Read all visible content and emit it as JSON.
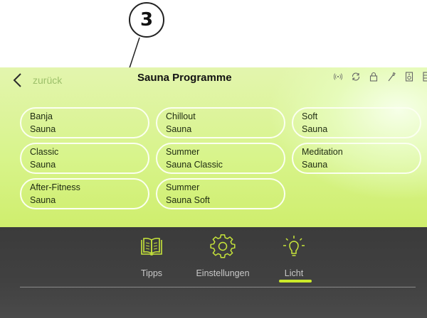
{
  "callout": {
    "number": "3"
  },
  "header": {
    "back_label": "zurück",
    "title": "Sauna Programme"
  },
  "status_icons": [
    "radio-signal-icon",
    "sync-icon",
    "lock-icon",
    "wrench-icon",
    "speaker-icon",
    "sauna-cabinet-icon"
  ],
  "programs": [
    {
      "name": "Banja",
      "type": "Sauna"
    },
    {
      "name": "Chillout",
      "type": "Sauna"
    },
    {
      "name": "Soft",
      "type": "Sauna"
    },
    {
      "name": "Classic",
      "type": "Sauna"
    },
    {
      "name": "Summer",
      "type": "Sauna Classic"
    },
    {
      "name": "Meditation",
      "type": "Sauna"
    },
    {
      "name": "After-Fitness",
      "type": "Sauna"
    },
    {
      "name": "Summer",
      "type": "Sauna Soft"
    }
  ],
  "nav": [
    {
      "label": "Tipps",
      "icon": "book-icon"
    },
    {
      "label": "Einstellungen",
      "icon": "gear-icon"
    },
    {
      "label": "Licht",
      "icon": "light-bulb-icon",
      "active": true
    }
  ],
  "colors": {
    "accent": "#cbe92a",
    "panel": "#d8f48c",
    "dark": "#3f3f3f"
  }
}
